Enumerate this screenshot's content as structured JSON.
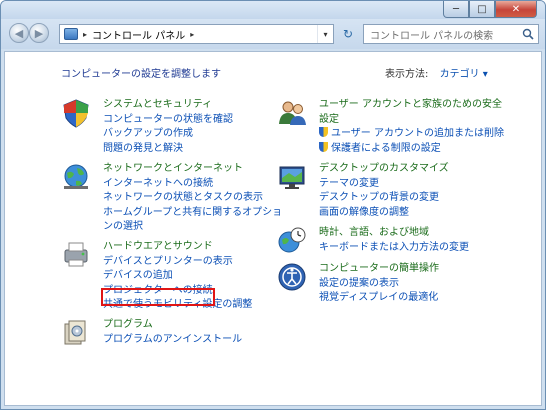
{
  "window": {
    "minimize_glyph": "─",
    "maximize_glyph": "□",
    "close_glyph": "✕"
  },
  "nav": {
    "back_glyph": "◀",
    "forward_glyph": "▶",
    "address_segments": [
      "コントロール パネル"
    ],
    "address_separator": "▸",
    "dropdown_glyph": "▾",
    "refresh_glyph": "↻",
    "search_placeholder": "コントロール パネルの検索"
  },
  "main": {
    "heading": "コンピューターの設定を調整します",
    "view_by_label": "表示方法:",
    "view_by_value": "カテゴリ ▾"
  },
  "categories": [
    {
      "key": "system",
      "icon": "shield-icon",
      "title": "システムとセキュリティ",
      "links": [
        "コンピューターの状態を確認",
        "バックアップの作成",
        "問題の発見と解決"
      ]
    },
    {
      "key": "network",
      "icon": "globe-network-icon",
      "title": "ネットワークとインターネット",
      "links": [
        "インターネットへの接続",
        "ネットワークの状態とタスクの表示",
        "ホームグループと共有に関するオプショ",
        "ンの選択"
      ]
    },
    {
      "key": "hardware",
      "icon": "printer-icon",
      "title": "ハードウエアとサウンド",
      "links": [
        "デバイスとプリンターの表示",
        "デバイスの追加",
        "プロジェクターへの接続",
        "共通で使うモビリティ設定の調整"
      ]
    },
    {
      "key": "programs",
      "icon": "programs-icon",
      "title": "プログラム",
      "links": [
        "プログラムのアンインストール"
      ]
    },
    {
      "key": "users",
      "icon": "users-icon",
      "title": "ユーザー アカウントと家族のための安全",
      "title2": "設定",
      "links": [
        "ユーザー アカウントの追加または削除",
        "保護者による制限の設定"
      ]
    },
    {
      "key": "appearance",
      "icon": "desktop-icon",
      "title": "デスクトップのカスタマイズ",
      "links": [
        "テーマの変更",
        "デスクトップの背景の変更",
        "画面の解像度の調整"
      ]
    },
    {
      "key": "clock",
      "icon": "clock-globe-icon",
      "title": "時計、言語、および地域",
      "links": [
        "キーボードまたは入力方法の変更"
      ]
    },
    {
      "key": "ease",
      "icon": "ease-of-access-icon",
      "title": "コンピューターの簡単操作",
      "links": [
        "設定の提案の表示",
        "視覚ディスプレイの最適化"
      ]
    }
  ],
  "colors": {
    "title_green": "#1a6b1a",
    "link_blue": "#0b4fb5",
    "heading_blue": "#1f3a93",
    "highlight_red": "#e01515"
  }
}
